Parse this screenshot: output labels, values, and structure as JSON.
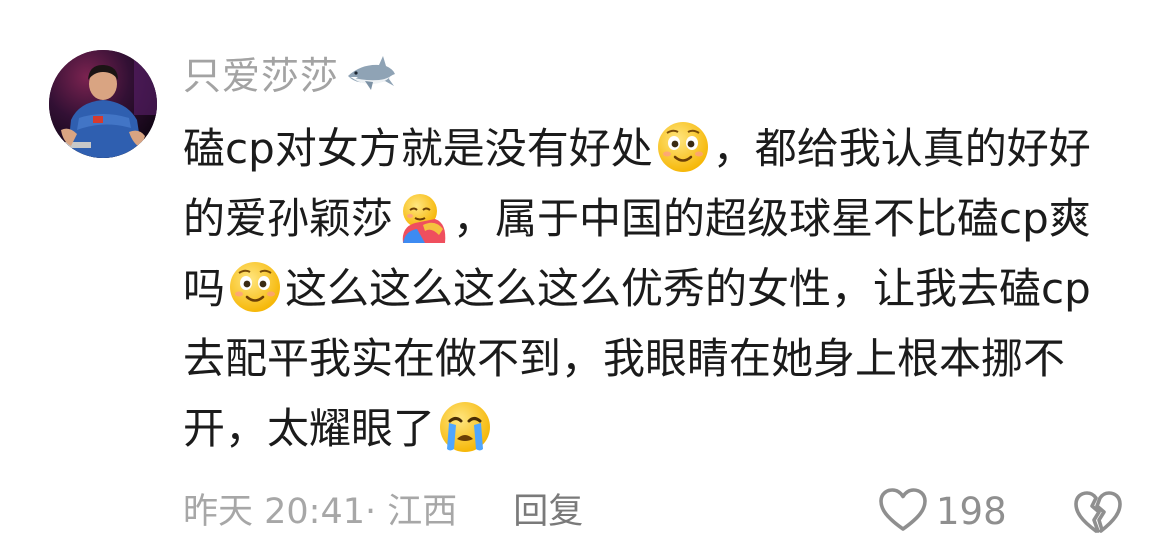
{
  "comment": {
    "username": "只爱莎莎",
    "username_badge_icon": "shark-icon",
    "body": [
      {
        "type": "text",
        "value": "磕cp对女方就是没有好处"
      },
      {
        "type": "emoji",
        "icon": "smiling-face-emoji"
      },
      {
        "type": "text",
        "value": "，都给我认真的好好的爱孙颖莎"
      },
      {
        "type": "emoji",
        "icon": "hugging-face-emoji"
      },
      {
        "type": "text",
        "value": "，属于中国的超级球星不比磕cp爽吗"
      },
      {
        "type": "emoji",
        "icon": "smiling-face-emoji"
      },
      {
        "type": "text",
        "value": "这么这么这么这么优秀的女性，让我去磕cp去配平我实在做不到，我眼睛在她身上根本挪不开，太耀眼了"
      },
      {
        "type": "emoji",
        "icon": "crying-face-emoji"
      }
    ],
    "timestamp": "昨天 20:41",
    "location": "· 江西",
    "reply_label": "回复",
    "like_icon": "heart-outline-icon",
    "like_count": "198",
    "dislike_icon": "broken-heart-outline-icon"
  },
  "colors": {
    "username": "#a3a3a3",
    "body_text": "#1b1b1b",
    "meta_text": "#a7a7a7",
    "reply_text": "#7a7a7a",
    "icon_stroke": "#8f8f8f"
  }
}
